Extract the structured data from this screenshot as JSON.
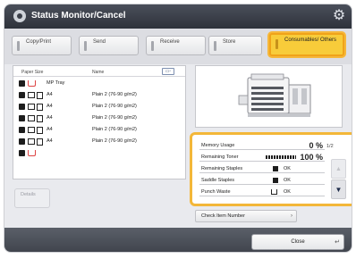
{
  "title": "Status Monitor/Cancel",
  "icons": {
    "title": "status-monitor-icon",
    "settings": "gear-icon"
  },
  "colors": {
    "highlight": "#f3b739",
    "active_tab": "#f8cc3a",
    "titlebar": "#2e323b"
  },
  "tabs": [
    {
      "label": "Copy/Print"
    },
    {
      "label": "Send"
    },
    {
      "label": "Receive"
    },
    {
      "label": "Store"
    },
    {
      "label": "Consumables/ Others",
      "active": true
    }
  ],
  "paper_list": {
    "columns": [
      "Paper Size",
      "Name"
    ],
    "rows": [
      {
        "source": "bypass",
        "size": "MP Tray",
        "type": ""
      },
      {
        "source": "drawer",
        "size": "A4",
        "type": "Plain 2 (76-90 g/m2)"
      },
      {
        "source": "drawer",
        "size": "A4",
        "type": "Plain 2 (76-90 g/m2)"
      },
      {
        "source": "drawer",
        "size": "A4",
        "type": "Plain 2 (76-90 g/m2)"
      },
      {
        "source": "drawer",
        "size": "A4",
        "type": "Plain 2 (76-90 g/m2)"
      },
      {
        "source": "drawer",
        "size": "A4",
        "type": "Plain 2 (76-90 g/m2)"
      },
      {
        "source": "bypass",
        "size": "",
        "type": ""
      }
    ]
  },
  "details_label": "Details",
  "status": {
    "memory_label": "Memory Usage",
    "memory_value": "0 %",
    "toner_label": "Remaining Toner",
    "toner_value": "100 %",
    "staples_label": "Remaining Staples",
    "staples_value": "OK",
    "saddle_label": "Saddle Staples",
    "saddle_value": "OK",
    "punch_label": "Punch Waste",
    "punch_value": "OK"
  },
  "pager": "1/2",
  "check_label": "Check Item Number",
  "close_label": "Close"
}
